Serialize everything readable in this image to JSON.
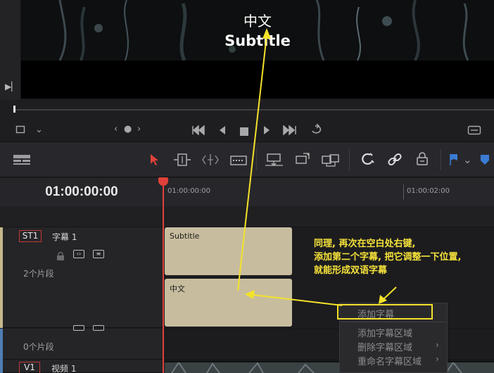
{
  "viewer": {
    "subtitle_cn": "中文",
    "subtitle_en": "Subtitle"
  },
  "timeline": {
    "timecode": "01:00:00:00",
    "ruler_labels": [
      "01:00:00:00",
      "01:00:02:00"
    ]
  },
  "tracks": [
    {
      "badge": "ST1",
      "name": "字幕 1",
      "clip_count": "2个片段",
      "strip_color": "#c6b88d"
    },
    {
      "badge": "",
      "name": "",
      "clip_count": "0个片段",
      "strip_color": "#4f7eb3"
    },
    {
      "badge": "V1",
      "name": "视频 1",
      "clip_count": "",
      "strip_color": "#4f7eb3"
    }
  ],
  "clips": [
    {
      "label": "Subtitle"
    },
    {
      "label": "中文"
    }
  ],
  "context_menu": {
    "items": [
      {
        "label": "添加字幕",
        "has_submenu": false
      },
      {
        "label": "添加字幕区域",
        "has_submenu": false
      },
      {
        "label": "删除字幕区域",
        "has_submenu": true
      },
      {
        "label": "重命名字幕区域",
        "has_submenu": true
      }
    ],
    "submenu_arrow": "›"
  },
  "annotation": {
    "lines": [
      "同理, 再次在空白处右键,",
      "添加第二个字幕, 把它调整一下位置,",
      "就能形成双语字幕"
    ],
    "color": "#f7e33a"
  },
  "colors": {
    "playhead": "#e0403a",
    "clip": "#c7bd9e",
    "annotation": "#f4e22a",
    "flag": "#3a7bd5"
  },
  "icons": {
    "play_side": "play-to-end-icon",
    "transport": [
      "crop-icon",
      "chevron-down-icon",
      "prev-marker-icon",
      "marker-dot-icon",
      "next-marker-icon",
      "skip-to-start-icon",
      "step-back-icon",
      "stop-icon",
      "play-icon",
      "skip-to-end-icon",
      "loop-icon",
      "fullscreen-icon"
    ],
    "tools": [
      "timeline-view-icon",
      "selection-arrow-icon",
      "trim-icon",
      "dynamic-trim-icon",
      "blade-icon",
      "insert-clip-icon",
      "overwrite-clip-icon",
      "replace-clip-icon",
      "snapping-icon",
      "link-icon",
      "lock-icon",
      "flag-icon",
      "chevron-down-icon",
      "marker-icon"
    ]
  }
}
